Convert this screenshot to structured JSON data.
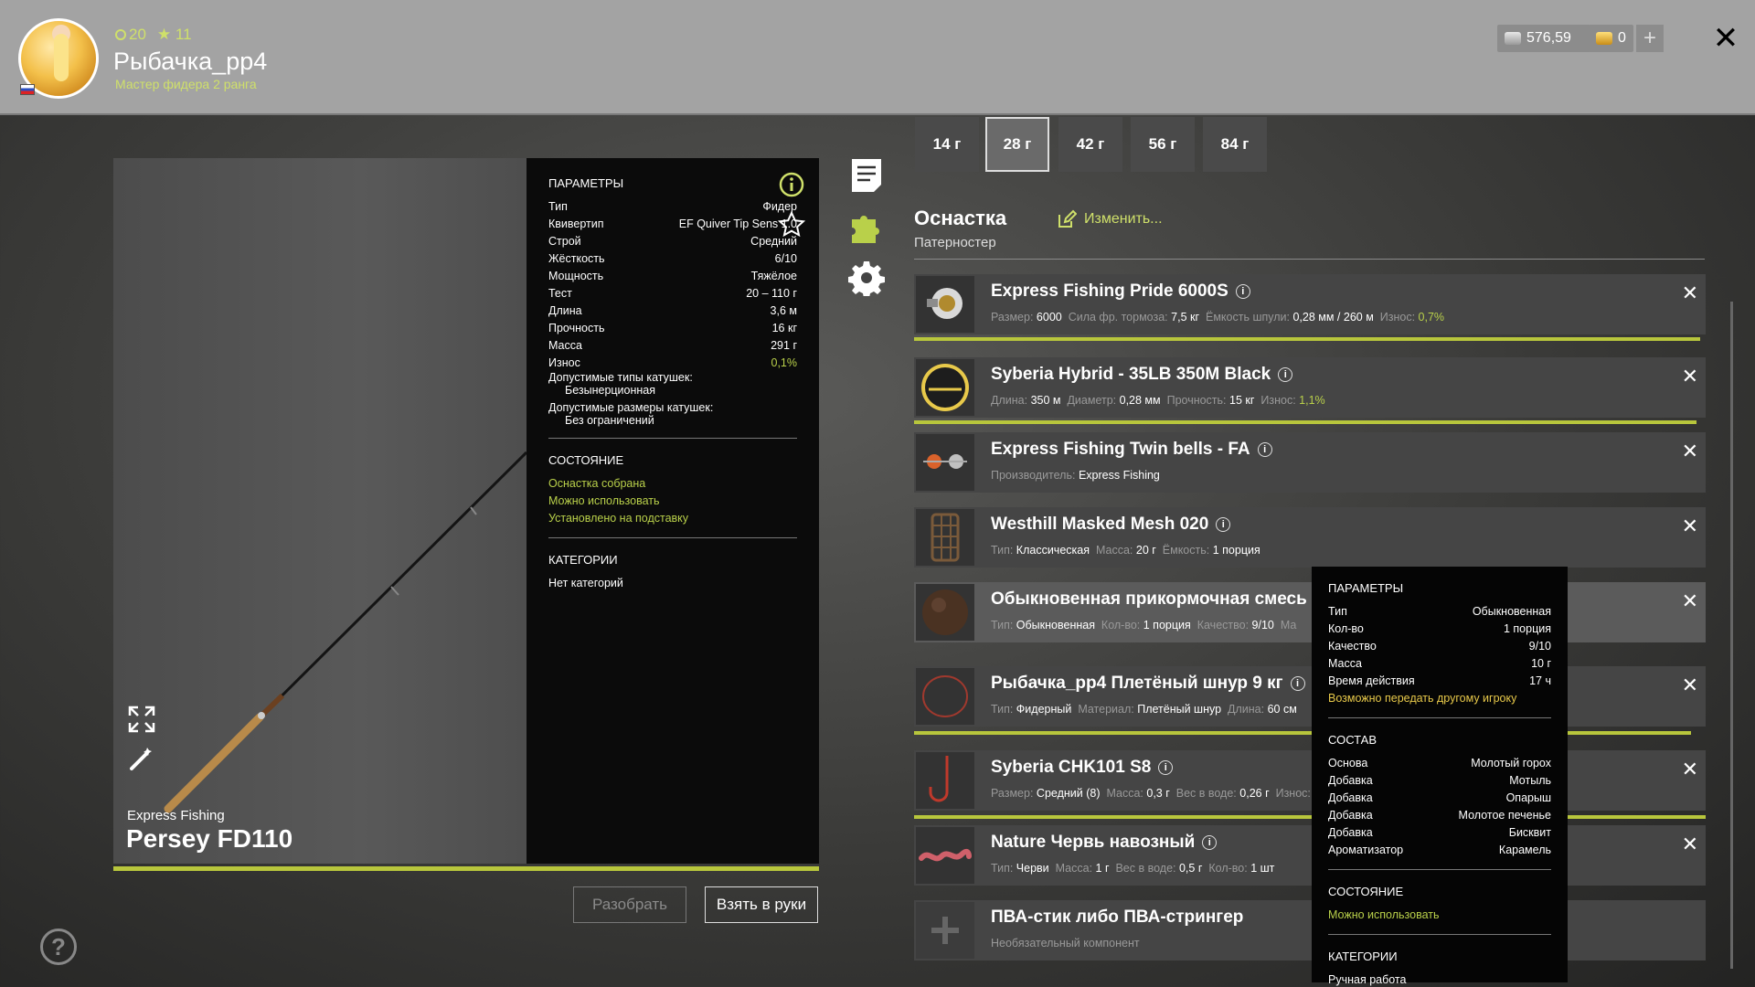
{
  "header": {
    "stat_coins": "20",
    "stat_stars": "11",
    "player_name": "Рыбачка_pp4",
    "player_rank": "Мастер фидера 2 ранга",
    "silver": "576,59",
    "gold": "0",
    "add_label": "+",
    "close_label": "✕"
  },
  "rod": {
    "brand": "Express Fishing",
    "name": "Persey FD110"
  },
  "params": {
    "title": "ПАРАМЕТРЫ",
    "rows": [
      {
        "k": "Тип",
        "v": "Фидер"
      },
      {
        "k": "Квивертип",
        "v": "EF Quiver Tip Sens 1.0"
      },
      {
        "k": "Строй",
        "v": "Средний"
      },
      {
        "k": "Жёсткость",
        "v": "6/10"
      },
      {
        "k": "Мощность",
        "v": "Тяжёлое"
      },
      {
        "k": "Тест",
        "v": "20 – 110 г"
      },
      {
        "k": "Длина",
        "v": "3,6 м"
      },
      {
        "k": "Прочность",
        "v": "16 кг"
      },
      {
        "k": "Масса",
        "v": "291 г"
      },
      {
        "k": "Износ",
        "v": "0,1%"
      }
    ],
    "reel_types_label": "Допустимые типы катушек:",
    "reel_types_value": "Безынерционная",
    "reel_sizes_label": "Допустимые размеры катушек:",
    "reel_sizes_value": "Без ограничений",
    "state_title": "СОСТОЯНИЕ",
    "state": [
      "Оснастка собрана",
      "Можно использовать",
      "Установлено на подставку"
    ],
    "cat_title": "КАТЕГОРИИ",
    "cat_value": "Нет категорий"
  },
  "buttons": {
    "disassemble": "Разобрать",
    "take": "Взять в руки"
  },
  "help_label": "?",
  "weights": [
    "14 г",
    "28 г",
    "42 г",
    "56 г",
    "84 г"
  ],
  "rig": {
    "title": "Оснастка",
    "subtitle": "Патерностер",
    "edit_label": "Изменить..."
  },
  "items": [
    {
      "name": "Express Fishing Pride 6000S",
      "meta": [
        [
          "Размер:",
          "6000"
        ],
        [
          "Сила фр. тормоза:",
          "7,5 кг"
        ],
        [
          "Ёмкость шпули:",
          "0,28 мм / 260 м"
        ],
        [
          "Износ:",
          "0,7%"
        ]
      ],
      "wear": 0.007
    },
    {
      "name": "Syberia Hybrid - 35LB 350M Black",
      "meta": [
        [
          "Длина:",
          "350 м"
        ],
        [
          "Диаметр:",
          "0,28 мм"
        ],
        [
          "Прочность:",
          "15 кг"
        ],
        [
          "Износ:",
          "1,1%"
        ]
      ],
      "wear": 0.011
    },
    {
      "name": "Express Fishing Twin bells - FA",
      "meta": [
        [
          "Производитель:",
          "Express Fishing"
        ]
      ]
    },
    {
      "name": "Westhill Masked Mesh 020",
      "meta": [
        [
          "Тип:",
          "Классическая"
        ],
        [
          "Масса:",
          "20 г"
        ],
        [
          "Ёмкость:",
          "1 порция"
        ]
      ]
    },
    {
      "name": "Обыкновенная прикормочная смесь",
      "meta": [
        [
          "Тип:",
          "Обыкновенная"
        ],
        [
          "Кол-во:",
          "1 порция"
        ],
        [
          "Качество:",
          "9/10"
        ],
        [
          "Ма",
          ""
        ]
      ]
    },
    {
      "name": "Рыбачка_pp4 Плетёный шнур 9 кг",
      "meta": [
        [
          "Тип:",
          "Фидерный"
        ],
        [
          "Материал:",
          "Плетёный шнур"
        ],
        [
          "Длина:",
          "60 см"
        ]
      ]
    },
    {
      "name": "Syberia CHK101 S8",
      "meta": [
        [
          "Размер:",
          "Средний (8)"
        ],
        [
          "Масса:",
          "0,3 г"
        ],
        [
          "Вес в воде:",
          "0,26 г"
        ],
        [
          "Износ:",
          ""
        ]
      ]
    },
    {
      "name": "Nature Червь навозный",
      "meta": [
        [
          "Тип:",
          "Черви"
        ],
        [
          "Масса:",
          "1 г"
        ],
        [
          "Вес в воде:",
          "0,5 г"
        ],
        [
          "Кол-во:",
          "1 шт"
        ]
      ]
    },
    {
      "name": "ПВА-стик либо ПВА-стрингер",
      "meta": [
        [
          "Необязательный компонент",
          ""
        ]
      ]
    }
  ],
  "tooltip": {
    "title": "ПАРАМЕТРЫ",
    "rows": [
      {
        "k": "Тип",
        "v": "Обыкновенная"
      },
      {
        "k": "Кол-во",
        "v": "1 порция"
      },
      {
        "k": "Качество",
        "v": "9/10"
      },
      {
        "k": "Масса",
        "v": "10 г"
      },
      {
        "k": "Время действия",
        "v": "17 ч"
      }
    ],
    "transfer": "Возможно передать другому игроку",
    "comp_title": "СОСТАВ",
    "comp": [
      {
        "k": "Основа",
        "v": "Молотый горох"
      },
      {
        "k": "Добавка",
        "v": "Мотыль"
      },
      {
        "k": "Добавка",
        "v": "Опарыш"
      },
      {
        "k": "Добавка",
        "v": "Молотое печенье"
      },
      {
        "k": "Добавка",
        "v": "Бисквит"
      },
      {
        "k": "Ароматизатор",
        "v": "Карамель"
      }
    ],
    "state_title": "СОСТОЯНИЕ",
    "state": "Можно использовать",
    "cat_title": "КАТЕГОРИИ",
    "cat": "Ручная работа"
  },
  "colors": {
    "accent": "#b8c63c",
    "green_text": "#b9d04a"
  }
}
